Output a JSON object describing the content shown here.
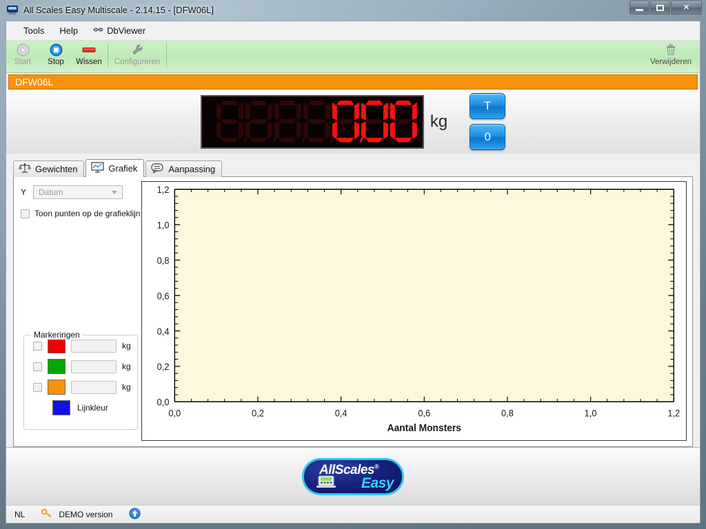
{
  "window": {
    "title": "All Scales Easy Multiscale - 2.14.15 - [DFW06L]",
    "app_icon": "allscales-easy-icon",
    "minimize_label": "–",
    "maximize_label": "□",
    "close_label": "✕"
  },
  "menu": {
    "items": [
      {
        "label": "Tools",
        "icon": null
      },
      {
        "label": "Help",
        "icon": null
      },
      {
        "label": "DbViewer",
        "icon": "dbviewer-icon"
      }
    ]
  },
  "toolbar": {
    "buttons": [
      {
        "label": "Start",
        "icon": "play-circle-icon",
        "enabled": false
      },
      {
        "label": "Stop",
        "icon": "stop-circle-icon",
        "enabled": true
      },
      {
        "label": "Wissen",
        "icon": "erase-bar-icon",
        "enabled": true
      },
      {
        "label": "Configureren",
        "icon": "wrench-icon",
        "enabled": false
      }
    ],
    "delete": {
      "label": "Verwijderen",
      "icon": "trash-icon"
    }
  },
  "device": {
    "name": "DFW06L",
    "bar_color": "#f7920b"
  },
  "display": {
    "digits": [
      "",
      "",
      "",
      "",
      "0",
      "0",
      "0"
    ],
    "decimal_after_index": 4,
    "value": "0.00",
    "unit": "kg",
    "lit_color": "#ff1010",
    "dim_color": "#2e0606",
    "buttons": [
      {
        "label": "T",
        "name": "tare-button"
      },
      {
        "label": "0",
        "name": "zero-button"
      }
    ]
  },
  "tabs": [
    {
      "label": "Gewichten",
      "icon": "balance-scale-icon",
      "active": false
    },
    {
      "label": "Grafiek",
      "icon": "chart-board-icon",
      "active": true
    },
    {
      "label": "Aanpassing",
      "icon": "speech-bubble-icon",
      "active": false
    }
  ],
  "controls": {
    "y_label": "Y",
    "y_select": {
      "value": "Datum",
      "enabled": false,
      "options": [
        "Datum"
      ]
    },
    "show_points": {
      "label": "Toon punten op de grafieklijn",
      "checked": false
    }
  },
  "markings": {
    "title": "Markeringen",
    "unit": "kg",
    "rows": [
      {
        "checked": false,
        "color": "#ee0000",
        "value": ""
      },
      {
        "checked": false,
        "color": "#00a800",
        "value": ""
      },
      {
        "checked": false,
        "color": "#f7920b",
        "value": ""
      }
    ],
    "line_color": {
      "label": "Lijnkleur",
      "color": "#1010e8"
    }
  },
  "chart_data": {
    "type": "line",
    "title": "",
    "xlabel": "Aantal Monsters",
    "ylabel": "",
    "x": [],
    "values": [],
    "series": [],
    "xlim": [
      0.0,
      1.2
    ],
    "ylim": [
      0.0,
      1.2
    ],
    "xticks": [
      0.0,
      0.2,
      0.4,
      0.6,
      0.8,
      1.0,
      1.2
    ],
    "yticks": [
      0.0,
      0.2,
      0.4,
      0.6,
      0.8,
      1.0,
      1.2
    ],
    "xticklabels": [
      "0,0",
      "0,2",
      "0,4",
      "0,6",
      "0,8",
      "1,0",
      "1,2"
    ],
    "yticklabels": [
      "0,0",
      "0,2",
      "0,4",
      "0,6",
      "0,8",
      "1,0",
      "1,2"
    ],
    "minor_ticks_per_major": 4,
    "grid": false,
    "legend": null,
    "plot_bg": "#fbf8dc",
    "axis_color": "#000000"
  },
  "logo": {
    "text_primary": "AllScales",
    "registered": "®",
    "text_secondary": "Easy",
    "icon": "scale-indicator-icon"
  },
  "statusbar": {
    "language": "NL",
    "key_icon": "key-icon",
    "license": "DEMO version",
    "update_icon": "update-arrow-icon"
  }
}
